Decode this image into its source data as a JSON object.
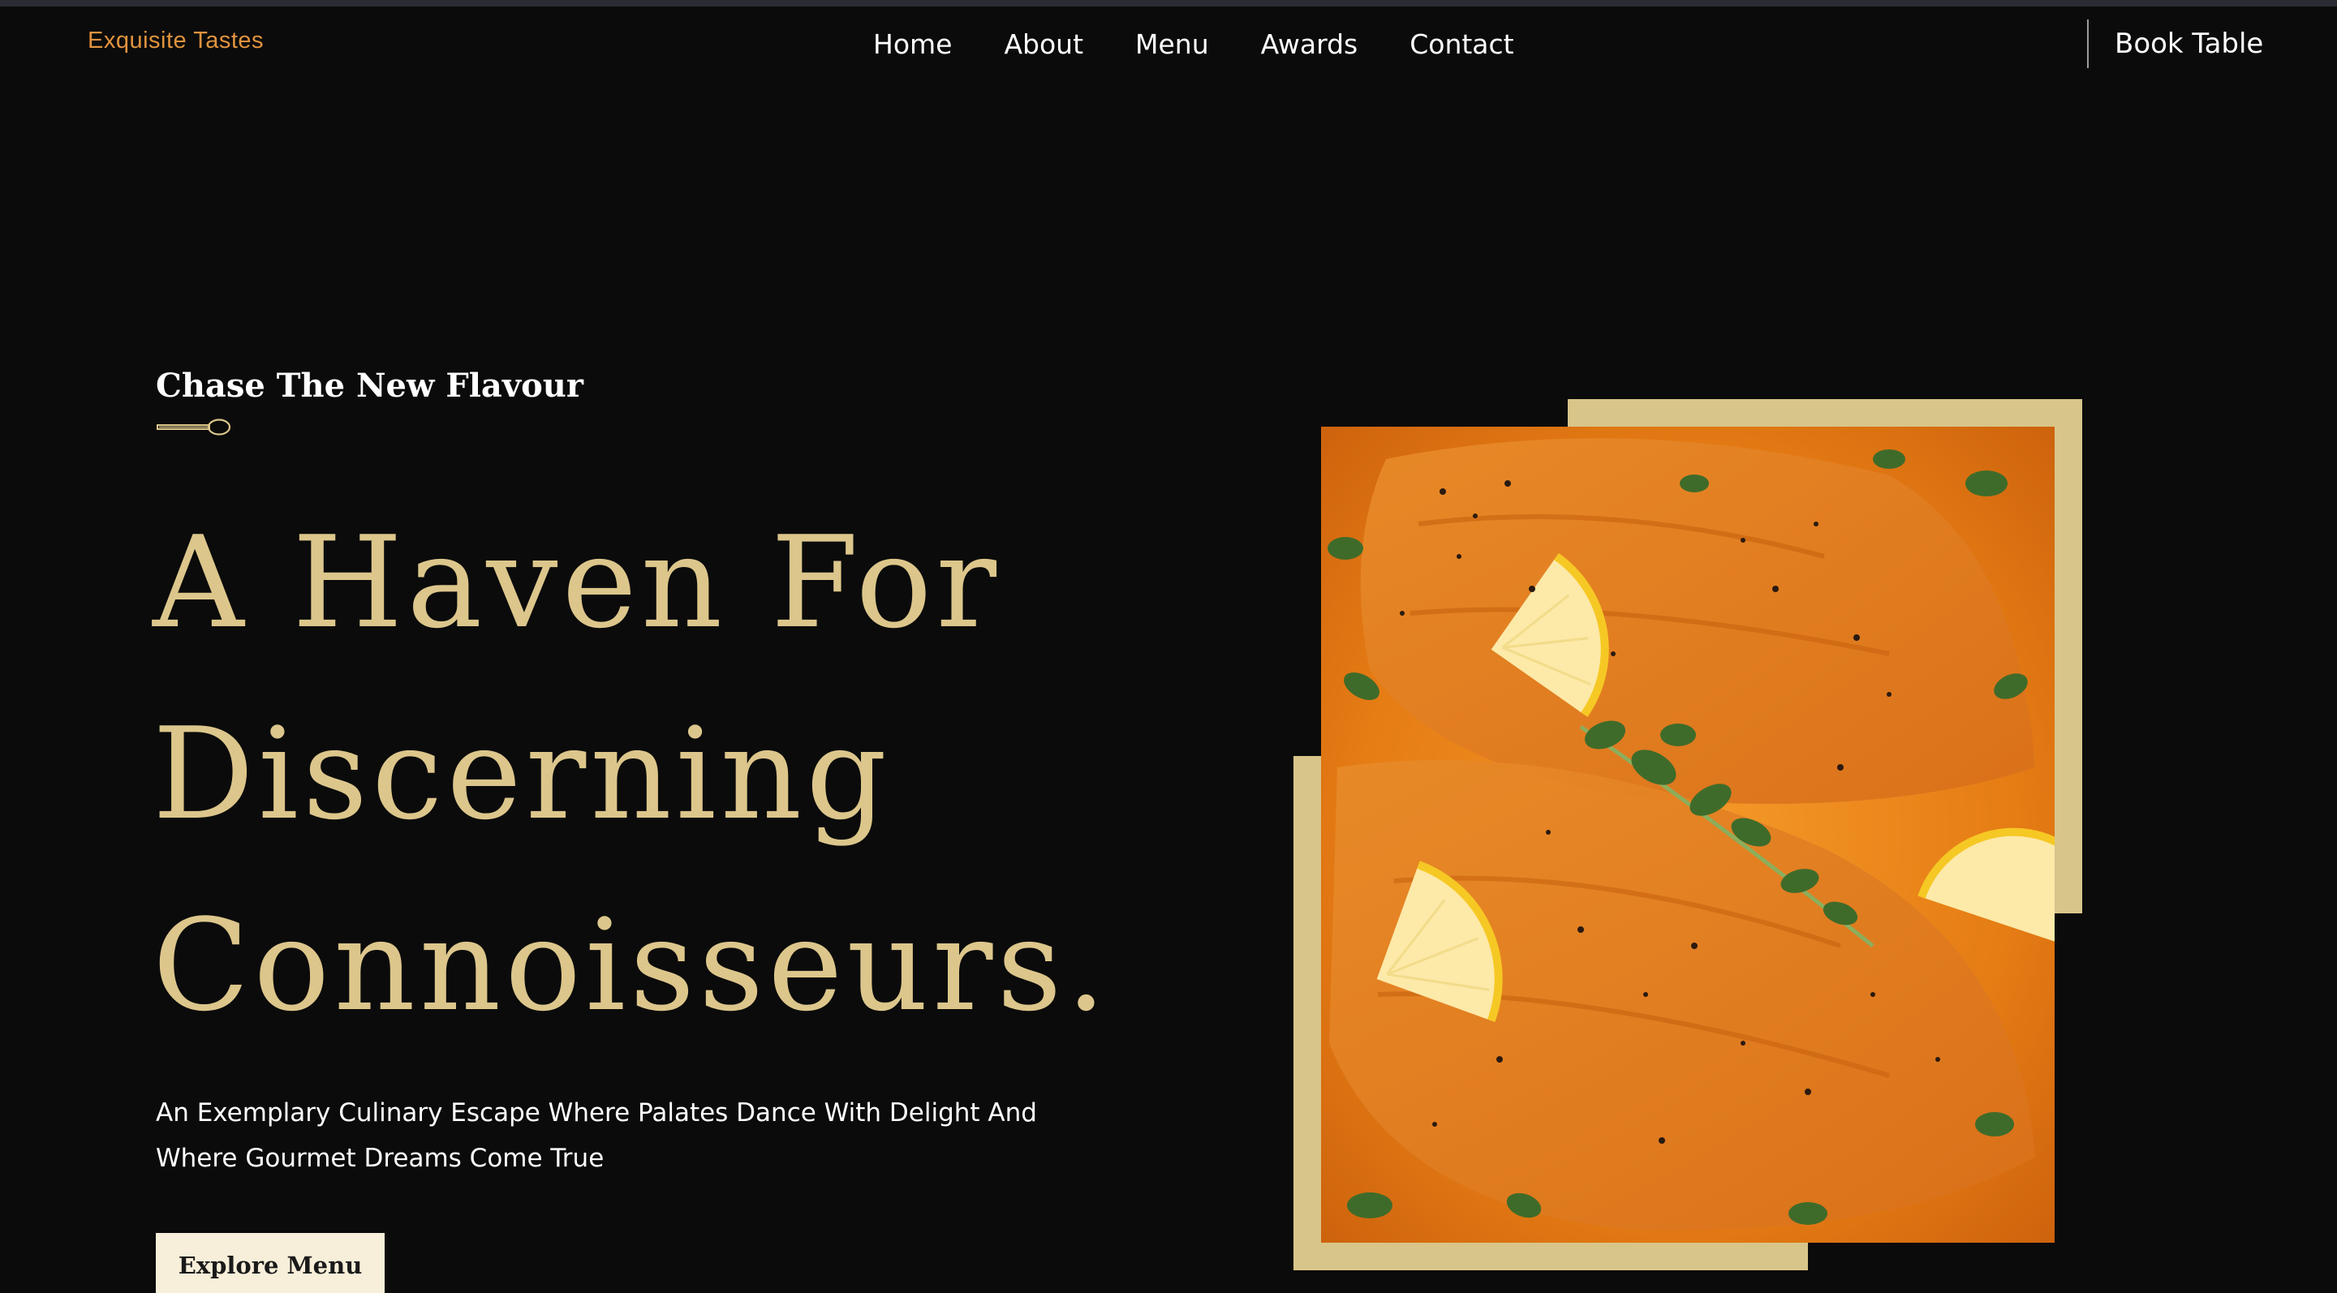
{
  "header": {
    "brand": "Exquisite Tastes",
    "nav": [
      {
        "label": "Home"
      },
      {
        "label": "About"
      },
      {
        "label": "Menu"
      },
      {
        "label": "Awards"
      },
      {
        "label": "Contact"
      }
    ],
    "cta": "Book Table"
  },
  "hero": {
    "tagline": "Chase The New Flavour",
    "title_lines": [
      "A Haven For",
      "Discerning",
      "Connoisseurs."
    ],
    "subtitle_lines": [
      "An Exemplary Culinary Escape Where Palates Dance With Delight And",
      "Where Gourmet Dreams Come True"
    ],
    "button": "Explore Menu"
  },
  "colors": {
    "background": "#0b0b0b",
    "brand": "#e0933e",
    "accent_gold": "#dcc68b",
    "frame": "#d8c58a",
    "button_bg": "#f8efda"
  },
  "icons": {
    "divider": "spoon-icon"
  }
}
